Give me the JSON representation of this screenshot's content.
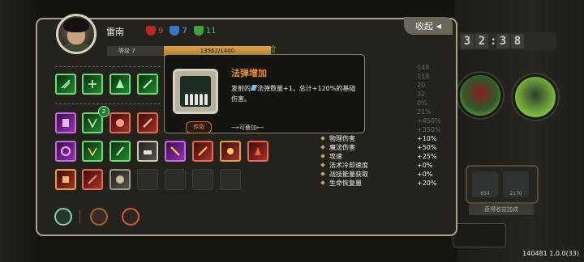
{
  "timer": [
    "3",
    "2",
    ":",
    "3",
    "8"
  ],
  "player": {
    "name": "雷南",
    "level_label": "等级 7",
    "xp_text": "13562/1400"
  },
  "kills": [
    {
      "count": "9",
      "color": "#e0443e"
    },
    {
      "count": "7",
      "color": "#5ba3f0"
    },
    {
      "count": "11",
      "color": "#4fc04a"
    }
  ],
  "collapse_label": "收起",
  "tooltip": {
    "title": "法弹增加",
    "desc_before": "发射的",
    "desc_after": "法弹数量+1，总计+120%的基础伤害。",
    "rarity": "传奇",
    "stack_note": "⟶可叠加⟵"
  },
  "stats": [
    {
      "label": "",
      "value": "148",
      "dim": true
    },
    {
      "label": "",
      "value": "118",
      "dim": true
    },
    {
      "label": "",
      "value": "20",
      "dim": true
    },
    {
      "label": "",
      "value": "32",
      "dim": true
    },
    {
      "label": "",
      "value": "0%",
      "dim": true
    },
    {
      "label": "",
      "value": "21%",
      "dim": true
    },
    {
      "label": "",
      "value": "+450%",
      "dim": true
    },
    {
      "label": "",
      "value": "+350%",
      "dim": true
    },
    {
      "label": "物理伤害",
      "value": "+10%",
      "dim": false
    },
    {
      "label": "魔法伤害",
      "value": "+50%",
      "dim": false
    },
    {
      "label": "攻速",
      "value": "+25%",
      "dim": false
    },
    {
      "label": "法术冷却速度",
      "value": "+0%",
      "dim": false
    },
    {
      "label": "战技能量获取",
      "value": "+0%",
      "dim": false
    },
    {
      "label": "生命恢复量",
      "value": "+20%",
      "dim": false
    }
  ],
  "side": {
    "lock_note": "获得收益加成",
    "slot_a": "654",
    "slot_b": "2170"
  },
  "version": "140481 1.0.0(33)",
  "colors": {
    "accent": "#e8952f",
    "panel_border": "#a9a290",
    "xp_bar": "#d9a346"
  }
}
